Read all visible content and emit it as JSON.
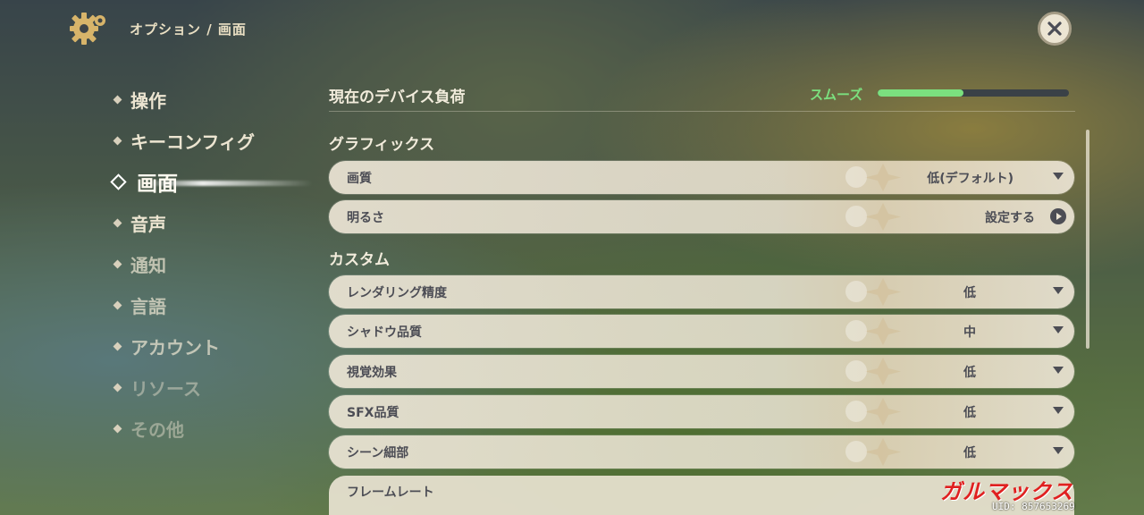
{
  "header": {
    "breadcrumb": "オプション / 画面"
  },
  "nav": {
    "items": [
      {
        "label": "操作"
      },
      {
        "label": "キーコンフィグ"
      },
      {
        "label": "画面",
        "active": true
      },
      {
        "label": "音声"
      },
      {
        "label": "通知"
      },
      {
        "label": "言語"
      },
      {
        "label": "アカウント"
      },
      {
        "label": "リソース"
      },
      {
        "label": "その他"
      }
    ]
  },
  "device_load": {
    "title": "現在のデバイス負荷",
    "status": "スムーズ",
    "level_fraction": 0.45,
    "status_color": "#7be07f"
  },
  "graphics": {
    "heading": "グラフィックス",
    "rows": [
      {
        "label": "画質",
        "value": "低(デフォルト)"
      },
      {
        "label": "明るさ",
        "value": "設定する"
      }
    ]
  },
  "custom": {
    "heading": "カスタム",
    "rows": [
      {
        "label": "レンダリング精度",
        "value": "低"
      },
      {
        "label": "シャドウ品質",
        "value": "中"
      },
      {
        "label": "視覚効果",
        "value": "低"
      },
      {
        "label": "SFX品質",
        "value": "低"
      },
      {
        "label": "シーン細部",
        "value": "低"
      },
      {
        "label": "フレームレート"
      }
    ]
  },
  "watermark": {
    "text": "ガルマックス"
  },
  "uid": "UID: 857653269",
  "icons": {
    "settings": "gear-icon",
    "close": "close-icon",
    "dropdown": "chevron-down-icon",
    "action": "play-circle-icon"
  }
}
